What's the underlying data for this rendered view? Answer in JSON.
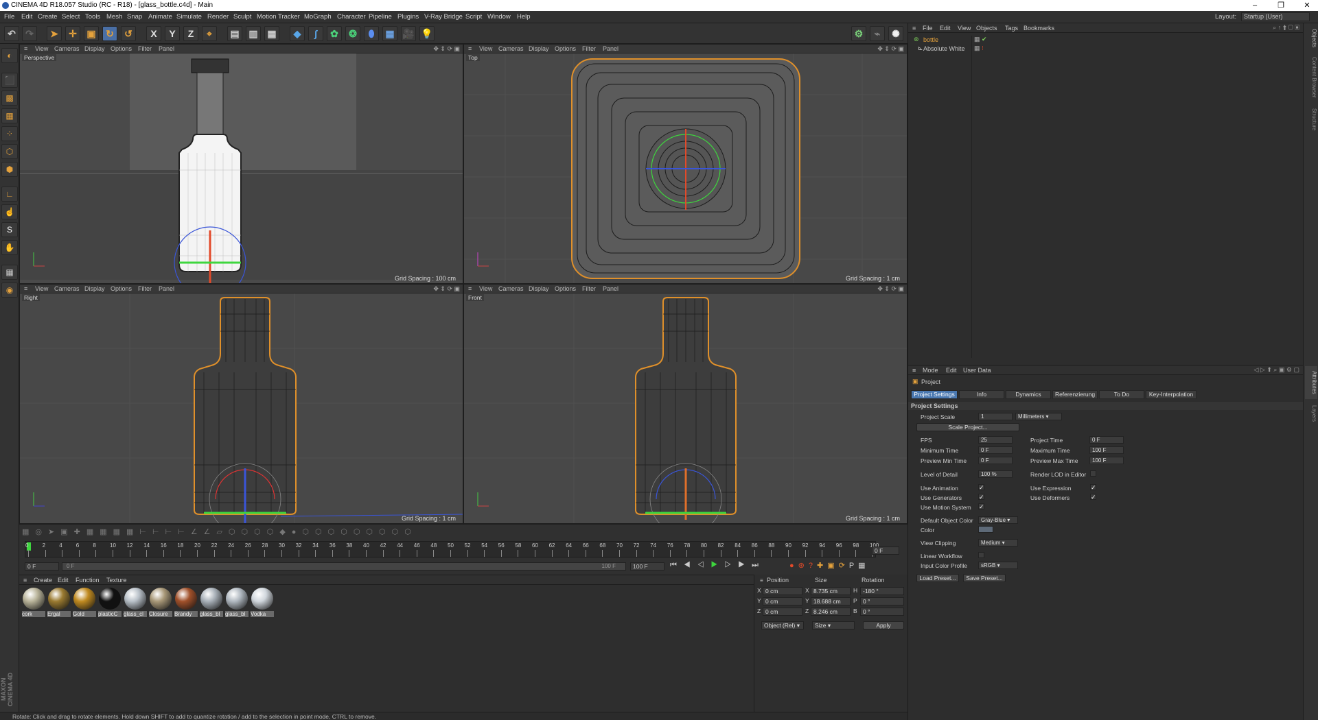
{
  "window": {
    "title": "CINEMA 4D R18.057 Studio (RC - R18) - [glass_bottle.c4d] - Main"
  },
  "menu": [
    "File",
    "Edit",
    "Create",
    "Select",
    "Tools",
    "Mesh",
    "Snap",
    "Animate",
    "Simulate",
    "Render",
    "Sculpt",
    "Motion Tracker",
    "MoGraph",
    "Character",
    "Pipeline",
    "Plugins",
    "V-Ray Bridge",
    "Script",
    "Window",
    "Help"
  ],
  "layout": {
    "label": "Layout:",
    "value": "Startup (User)"
  },
  "toolbar": {
    "x": "X",
    "y": "Y",
    "z": "Z"
  },
  "viewport_menu": [
    "View",
    "Cameras",
    "Display",
    "Options",
    "Filter",
    "Panel"
  ],
  "viewports": {
    "perspective": {
      "name": "Perspective",
      "grid": "Grid Spacing : 100 cm"
    },
    "top": {
      "name": "Top",
      "grid": "Grid Spacing : 1 cm"
    },
    "right": {
      "name": "Right",
      "grid": "Grid Spacing : 1 cm"
    },
    "front": {
      "name": "Front",
      "grid": "Grid Spacing : 1 cm"
    }
  },
  "timeline": {
    "ticks": [
      "0",
      "2",
      "4",
      "6",
      "8",
      "10",
      "12",
      "14",
      "16",
      "18",
      "20",
      "22",
      "24",
      "26",
      "28",
      "30",
      "32",
      "34",
      "36",
      "38",
      "40",
      "42",
      "44",
      "46",
      "48",
      "50",
      "52",
      "54",
      "56",
      "58",
      "60",
      "62",
      "64",
      "66",
      "68",
      "70",
      "72",
      "74",
      "76",
      "78",
      "80",
      "82",
      "84",
      "86",
      "88",
      "90",
      "92",
      "94",
      "96",
      "98",
      "100"
    ],
    "current_frame": "0 F",
    "start_field": "0 F",
    "slider_start": "0 F",
    "slider_end": "100 F",
    "end_field": "100 F"
  },
  "material_manager": {
    "menu": [
      "Create",
      "Edit",
      "Function",
      "Texture"
    ],
    "materials": [
      {
        "name": "cork",
        "color": "#b9b49a"
      },
      {
        "name": "Ergal",
        "color": "#9a7a30"
      },
      {
        "name": "Gold",
        "color": "#c08a20"
      },
      {
        "name": "plasticC",
        "color": "#111111"
      },
      {
        "name": "glass_cl",
        "color": "#b8c0c8"
      },
      {
        "name": "Closure",
        "color": "#a89878"
      },
      {
        "name": "Brandy",
        "color": "#a0502a"
      },
      {
        "name": "glass_bl",
        "color": "#a8b0b8"
      },
      {
        "name": "glass_bl",
        "color": "#b0b8c0"
      },
      {
        "name": "Vodka",
        "color": "#d0d6dc"
      }
    ]
  },
  "coordinates": {
    "headers": {
      "position": "Position",
      "size": "Size",
      "rotation": "Rotation"
    },
    "rows": [
      {
        "axis": "X",
        "pos": "0 cm",
        "size_axis": "X",
        "size": "8.735 cm",
        "rot_axis": "H",
        "rot": "-180 °"
      },
      {
        "axis": "Y",
        "pos": "0 cm",
        "size_axis": "Y",
        "size": "18.688 cm",
        "rot_axis": "P",
        "rot": "0 °"
      },
      {
        "axis": "Z",
        "pos": "0 cm",
        "size_axis": "Z",
        "size": "8.246 cm",
        "rot_axis": "B",
        "rot": "0 °"
      }
    ],
    "mode": "Object (Rel)",
    "size_mode": "Size",
    "apply": "Apply"
  },
  "object_manager": {
    "menu": [
      "File",
      "Edit",
      "View",
      "Objects",
      "Tags",
      "Bookmarks"
    ],
    "objects": [
      {
        "name": "bottle",
        "color": "#7fd35c"
      },
      {
        "name": "Absolute White",
        "color": "#c8c8c8"
      }
    ]
  },
  "attribute_manager": {
    "menu": [
      "Mode",
      "Edit",
      "User Data"
    ],
    "object": "Project",
    "tabs": [
      "Project Settings",
      "Info",
      "Dynamics",
      "Referenzierung",
      "To Do",
      "Key-Interpolation"
    ],
    "section": "Project Settings",
    "project_scale": {
      "label": "Project Scale",
      "value": "1",
      "unit": "Millimeters"
    },
    "scale_project": "Scale Project...",
    "fps": {
      "label": "FPS",
      "value": "25"
    },
    "project_time": {
      "label": "Project Time",
      "value": "0 F"
    },
    "min_time": {
      "label": "Minimum Time",
      "value": "0 F"
    },
    "max_time": {
      "label": "Maximum Time",
      "value": "100 F"
    },
    "prev_min": {
      "label": "Preview Min Time",
      "value": "0 F"
    },
    "prev_max": {
      "label": "Preview Max Time",
      "value": "100 F"
    },
    "lod": {
      "label": "Level of Detail",
      "value": "100 %"
    },
    "render_lod": "Render LOD in Editor",
    "use_animation": "Use Animation",
    "use_expression": "Use Expression",
    "use_generators": "Use Generators",
    "use_deformers": "Use Deformers",
    "use_motion": "Use Motion System",
    "default_color": {
      "label": "Default Object Color",
      "value": "Gray-Blue"
    },
    "color": "Color",
    "view_clipping": {
      "label": "View Clipping",
      "value": "Medium"
    },
    "linear_workflow": "Linear Workflow",
    "input_profile": {
      "label": "Input Color Profile",
      "value": "sRGB"
    },
    "load_preset": "Load Preset...",
    "save_preset": "Save Preset..."
  },
  "right_tabs": [
    "Objects",
    "Content Browser",
    "Structure",
    "Attributes",
    "Layers"
  ],
  "status": "Rotate: Click and drag to rotate elements. Hold down SHIFT to add to quantize rotation / add to the selection in point mode, CTRL to remove.",
  "maxon": "MAXON CINEMA 4D"
}
